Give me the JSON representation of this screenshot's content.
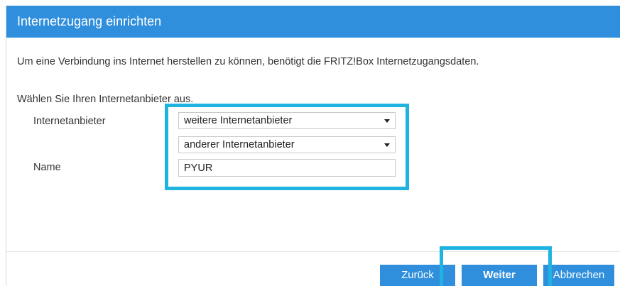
{
  "header": {
    "title": "Internetzugang einrichten"
  },
  "content": {
    "intro_text": "Um eine Verbindung ins Internet herstellen zu können, benötigt die FRITZ!Box Internetzugangsdaten.",
    "provider_prompt": "Wählen Sie Ihren Internetanbieter aus.",
    "provider_label": "Internetanbieter",
    "provider_select_value": "weitere Internetanbieter",
    "provider_subselect_value": "anderer Internetanbieter",
    "name_label": "Name",
    "name_value": "PYUR"
  },
  "buttons": {
    "back": "Zurück",
    "next": "Weiter",
    "cancel": "Abbrechen"
  },
  "colors": {
    "header_bg": "#2f8fdc",
    "button_bg": "#2f8fdc",
    "highlight": "#1fb3e0"
  }
}
